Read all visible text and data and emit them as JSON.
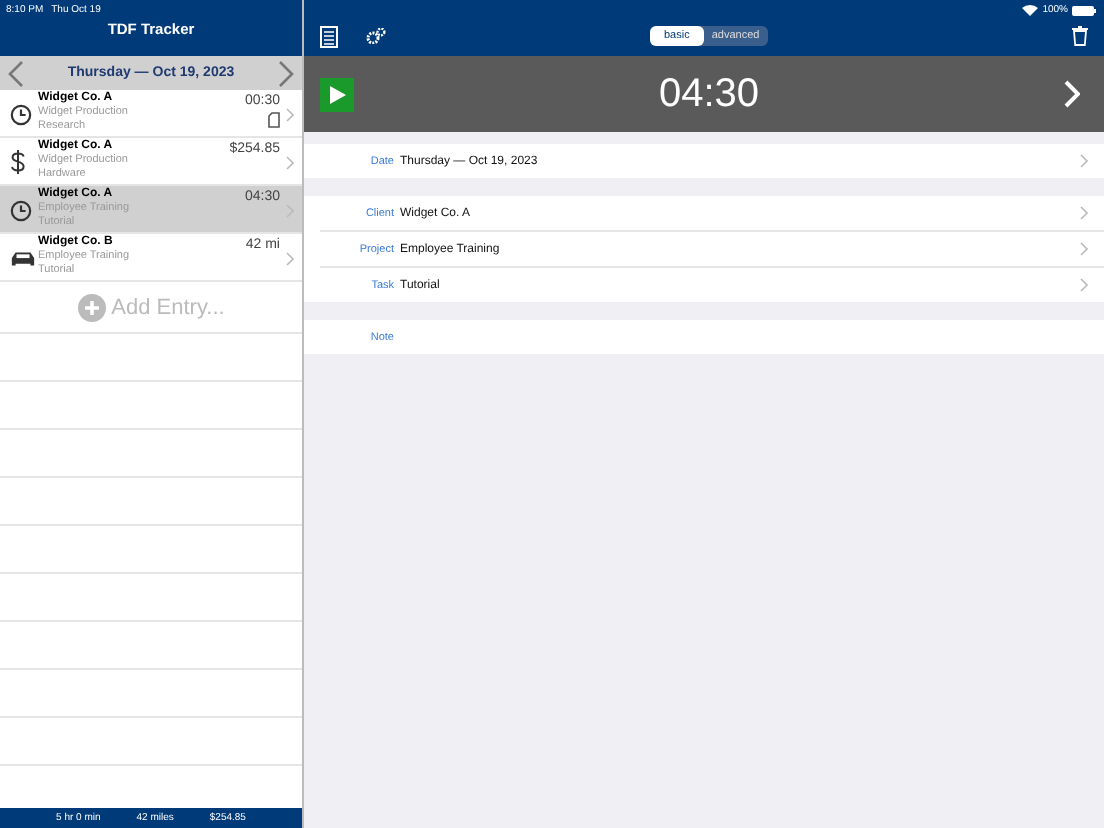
{
  "status_bar": {
    "time": "8:10 PM",
    "date": "Thu Oct 19",
    "battery": "100%"
  },
  "sidebar": {
    "title": "TDF Tracker",
    "date": "Thursday — Oct 19, 2023",
    "entries": [
      {
        "kind": "time",
        "client": "Widget Co. A",
        "project": "Widget Production",
        "task": "Research",
        "amount": "00:30",
        "has_note": true,
        "selected": false
      },
      {
        "kind": "expense",
        "client": "Widget Co. A",
        "project": "Widget Production",
        "task": "Hardware",
        "amount": "$254.85",
        "has_note": false,
        "selected": false
      },
      {
        "kind": "time",
        "client": "Widget Co. A",
        "project": "Employee Training",
        "task": "Tutorial",
        "amount": "04:30",
        "has_note": false,
        "selected": true
      },
      {
        "kind": "mileage",
        "client": "Widget Co. B",
        "project": "Employee Training",
        "task": "Tutorial",
        "amount": "42 mi",
        "has_note": false,
        "selected": false
      }
    ],
    "add_entry": "Add Entry...",
    "totals": [
      "5 hr 0 min",
      "42 miles",
      "$254.85"
    ]
  },
  "toolbar": {
    "segments": [
      {
        "label": "basic",
        "selected": true
      },
      {
        "label": "advanced",
        "selected": false
      }
    ]
  },
  "timer": {
    "value": "04:30"
  },
  "detail": {
    "groups": [
      [
        {
          "label": "Date",
          "value": "Thursday — Oct 19, 2023",
          "chevron": true
        }
      ],
      [
        {
          "label": "Client",
          "value": "Widget Co. A",
          "chevron": true
        },
        {
          "label": "Project",
          "value": "Employee Training",
          "chevron": true
        },
        {
          "label": "Task",
          "value": "Tutorial",
          "chevron": true
        }
      ],
      [
        {
          "label": "Note",
          "chevron": false
        }
      ]
    ]
  }
}
